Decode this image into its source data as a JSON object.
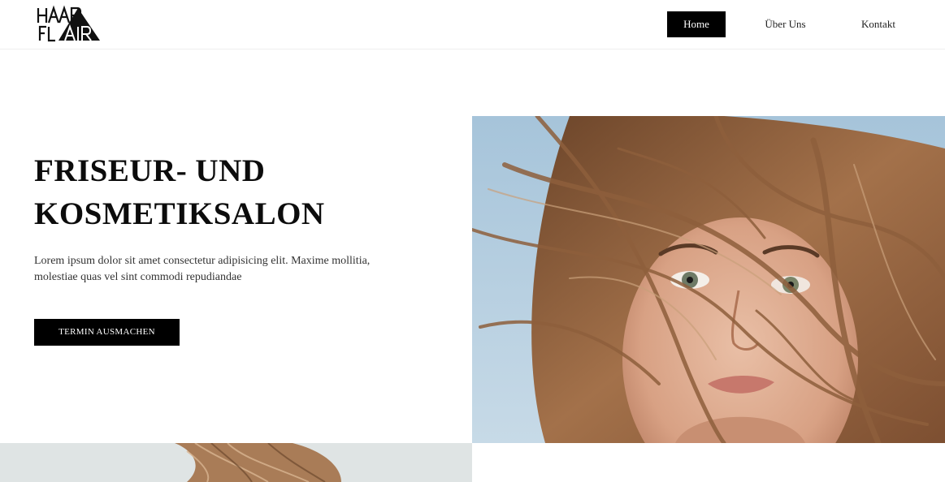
{
  "brand": {
    "logo_top": "HAAR",
    "logo_bottom": "FLAIR"
  },
  "nav": [
    {
      "label": "Home",
      "active": true
    },
    {
      "label": "Über Uns",
      "active": false
    },
    {
      "label": "Kontakt",
      "active": false
    }
  ],
  "hero": {
    "title_line1": "FRISEUR- UND",
    "title_line2": "KOSMETIKSALON",
    "text_line1": "Lorem ipsum dolor sit amet consectetur adipisicing elit. Maxime mollitia,",
    "text_line2": "molestiae quas vel sint commodi repudiandae",
    "cta_label": "TERMIN AUSMACHEN"
  },
  "colors": {
    "accent": "#000000",
    "background": "#ffffff",
    "sky": "#a9c6dc",
    "hair": "#8a5a36"
  }
}
